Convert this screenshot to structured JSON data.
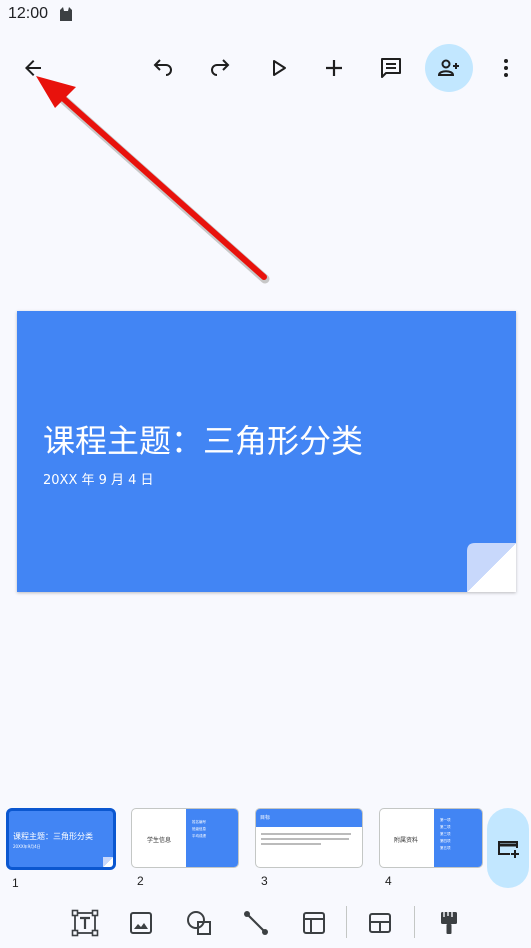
{
  "status_bar": {
    "time": "12:00"
  },
  "toolbar": {
    "icons": [
      "back-arrow-icon",
      "undo-icon",
      "redo-icon",
      "play-icon",
      "add-icon",
      "comment-icon",
      "add-person-icon",
      "more-vert-icon"
    ]
  },
  "slide": {
    "title": "课程主题：三角形分类",
    "date": "20XX 年 9 月 4 日",
    "background": "#4285f4"
  },
  "filmstrip": {
    "slides": [
      {
        "number": "1",
        "title": "课程主题：三角形分类",
        "date": "20XX年9月4日",
        "selected": true
      },
      {
        "number": "2",
        "title": "学生信息",
        "bullets": [
          "姓名编号",
          "班级信息",
          "平均成绩"
        ]
      },
      {
        "number": "3",
        "title": "目标"
      },
      {
        "number": "4",
        "title": "附属资料",
        "bullets": [
          "第一项",
          "第二项",
          "第三项",
          "第四项",
          "第五项"
        ]
      }
    ]
  },
  "bottom_toolbar": {
    "icons": [
      "text-box-icon",
      "image-icon",
      "shapes-icon",
      "line-icon",
      "table-icon",
      "layout-icon",
      "paint-format-icon"
    ]
  },
  "colors": {
    "accent": "#0b57d0",
    "slide_blue": "#4285f4",
    "share_bg": "#c2e7ff",
    "arrow": "#e8120c"
  }
}
